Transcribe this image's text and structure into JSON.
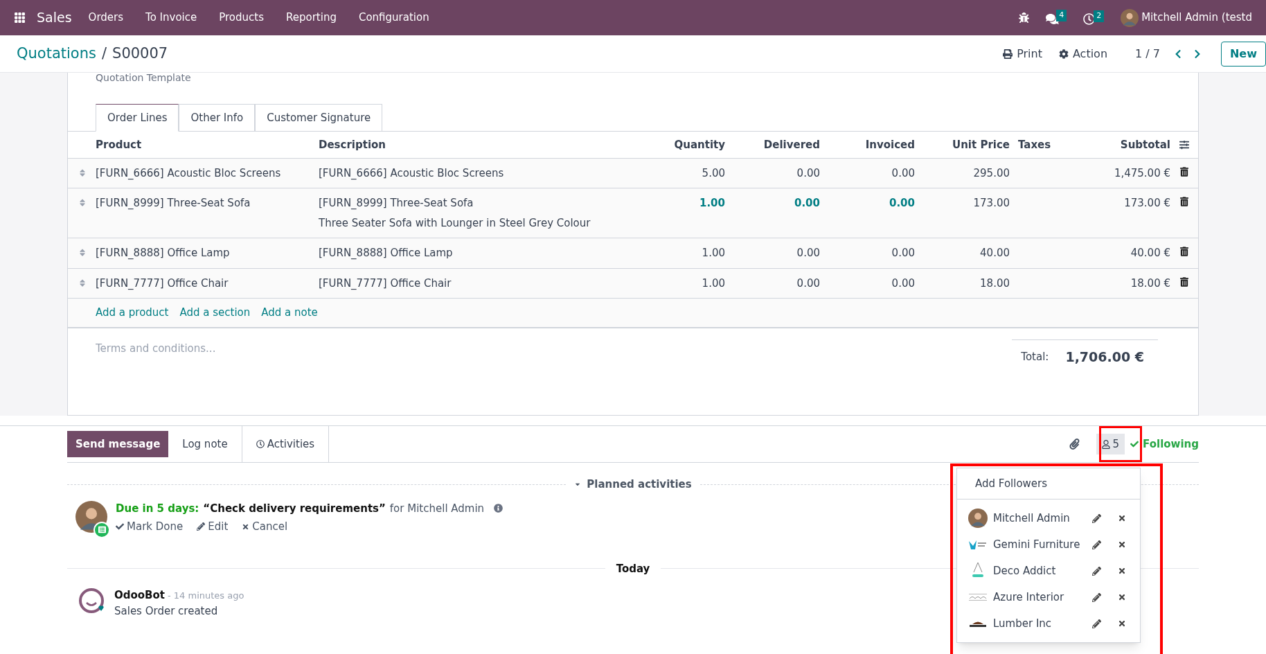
{
  "navbar": {
    "app": "Sales",
    "menu": [
      "Orders",
      "To Invoice",
      "Products",
      "Reporting",
      "Configuration"
    ],
    "messages_count": "4",
    "activities_count": "2",
    "user": "Mitchell Admin (testd"
  },
  "breadcrumb": {
    "parent": "Quotations",
    "separator": "/",
    "current": "S00007"
  },
  "control_panel": {
    "print": "Print",
    "action": "Action",
    "pager": "1 / 7",
    "new": "New"
  },
  "form": {
    "field_label": "Quotation Template",
    "tabs": [
      {
        "label": "Order Lines",
        "selected": true
      },
      {
        "label": "Other Info",
        "selected": false
      },
      {
        "label": "Customer Signature",
        "selected": false
      }
    ],
    "table": {
      "columns": [
        "Product",
        "Description",
        "Quantity",
        "Delivered",
        "Invoiced",
        "Unit Price",
        "Taxes",
        "Subtotal"
      ],
      "rows": [
        {
          "product": "[FURN_6666] Acoustic Bloc Screens",
          "description": [
            "[FURN_6666] Acoustic Bloc Screens"
          ],
          "quantity": "5.00",
          "delivered": "0.00",
          "invoiced": "0.00",
          "unit_price": "295.00",
          "subtotal": "1,475.00 €",
          "highlighted": false
        },
        {
          "product": "[FURN_8999] Three-Seat Sofa",
          "description": [
            "[FURN_8999] Three-Seat Sofa",
            "Three Seater Sofa with Lounger in Steel Grey Colour"
          ],
          "quantity": "1.00",
          "delivered": "0.00",
          "invoiced": "0.00",
          "unit_price": "173.00",
          "subtotal": "173.00 €",
          "highlighted": true
        },
        {
          "product": "[FURN_8888] Office Lamp",
          "description": [
            "[FURN_8888] Office Lamp"
          ],
          "quantity": "1.00",
          "delivered": "0.00",
          "invoiced": "0.00",
          "unit_price": "40.00",
          "subtotal": "40.00 €",
          "highlighted": false
        },
        {
          "product": "[FURN_7777] Office Chair",
          "description": [
            "[FURN_7777] Office Chair"
          ],
          "quantity": "1.00",
          "delivered": "0.00",
          "invoiced": "0.00",
          "unit_price": "18.00",
          "subtotal": "18.00 €",
          "highlighted": false
        }
      ],
      "add_links": [
        "Add a product",
        "Add a section",
        "Add a note"
      ]
    },
    "terms": {
      "placeholder": "Terms and conditions..."
    },
    "total": {
      "label": "Total:",
      "value": "1,706.00 €"
    }
  },
  "chatter": {
    "composer_buttons": [
      {
        "label": "Send message",
        "kind": "primary"
      },
      {
        "label": "Log note",
        "kind": "plain"
      },
      {
        "label": "Activities",
        "kind": "icon"
      }
    ],
    "followers_count": "5",
    "following": "Following",
    "planned_title": "Planned activities",
    "activity": {
      "due": "Due in 5 days:",
      "summary": "“Check delivery requirements”",
      "assignee": "for Mitchell Admin",
      "actions": [
        "Mark Done",
        "Edit",
        "Cancel"
      ]
    },
    "date_separator": "Today",
    "message": {
      "author": "OdooBot",
      "time": "- 14 minutes ago",
      "body": "Sales Order created"
    },
    "followers_menu": {
      "add": "Add Followers",
      "followers": [
        {
          "name": "Mitchell Admin",
          "kind": "person"
        },
        {
          "name": "Gemini Furniture",
          "kind": "gemini"
        },
        {
          "name": "Deco Addict",
          "kind": "deco"
        },
        {
          "name": "Azure Interior",
          "kind": "azure"
        },
        {
          "name": "Lumber Inc",
          "kind": "lumber"
        }
      ]
    }
  }
}
